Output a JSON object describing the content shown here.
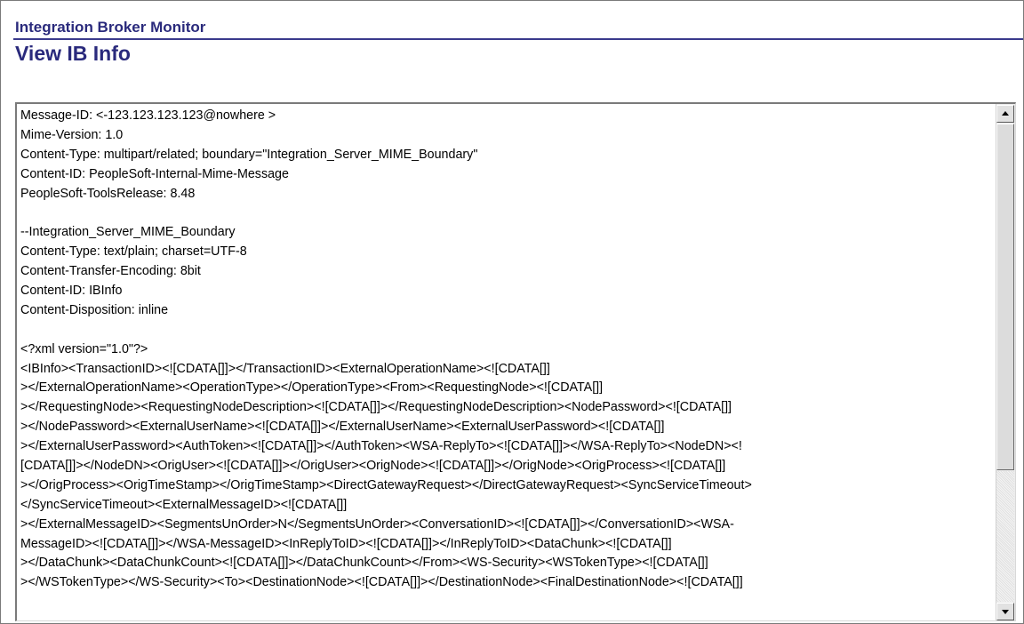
{
  "header": {
    "component_title": "Integration Broker Monitor",
    "page_title": "View IB Info"
  },
  "message": {
    "lines": [
      "Message-ID: <-123.123.123.123@nowhere >",
      "Mime-Version: 1.0",
      "Content-Type: multipart/related; boundary=\"Integration_Server_MIME_Boundary\"",
      "Content-ID: PeopleSoft-Internal-Mime-Message",
      "PeopleSoft-ToolsRelease: 8.48",
      "",
      "--Integration_Server_MIME_Boundary",
      "Content-Type: text/plain; charset=UTF-8",
      "Content-Transfer-Encoding: 8bit",
      "Content-ID: IBInfo",
      "Content-Disposition: inline",
      "",
      "<?xml version=\"1.0\"?>",
      "<IBInfo><TransactionID><![CDATA[]]></TransactionID><ExternalOperationName><![CDATA[]]",
      "></ExternalOperationName><OperationType></OperationType><From><RequestingNode><![CDATA[]]",
      "></RequestingNode><RequestingNodeDescription><![CDATA[]]></RequestingNodeDescription><NodePassword><![CDATA[]]",
      "></NodePassword><ExternalUserName><![CDATA[]]></ExternalUserName><ExternalUserPassword><![CDATA[]]",
      "></ExternalUserPassword><AuthToken><![CDATA[]]></AuthToken><WSA-ReplyTo><![CDATA[]]></WSA-ReplyTo><NodeDN><!",
      "[CDATA[]]></NodeDN><OrigUser><![CDATA[]]></OrigUser><OrigNode><![CDATA[]]></OrigNode><OrigProcess><![CDATA[]]",
      "></OrigProcess><OrigTimeStamp></OrigTimeStamp><DirectGatewayRequest></DirectGatewayRequest><SyncServiceTimeout>",
      "</SyncServiceTimeout><ExternalMessageID><![CDATA[]]",
      "></ExternalMessageID><SegmentsUnOrder>N</SegmentsUnOrder><ConversationID><![CDATA[]]></ConversationID><WSA-",
      "MessageID><![CDATA[]]></WSA-MessageID><InReplyToID><![CDATA[]]></InReplyToID><DataChunk><![CDATA[]]",
      "></DataChunk><DataChunkCount><![CDATA[]]></DataChunkCount></From><WS-Security><WSTokenType><![CDATA[]]",
      "></WSTokenType></WS-Security><To><DestinationNode><![CDATA[]]></DestinationNode><FinalDestinationNode><![CDATA[]]"
    ]
  },
  "icons": {
    "scroll_up": "scroll-up-arrow-icon",
    "scroll_down": "scroll-down-arrow-icon"
  },
  "colors": {
    "title": "#2a2a7c",
    "rule": "#3a3a8c"
  }
}
